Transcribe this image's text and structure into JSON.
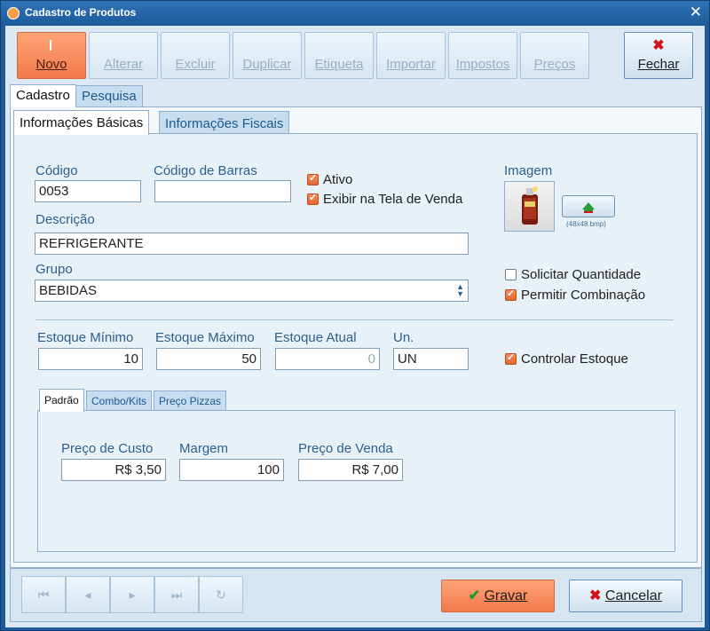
{
  "window": {
    "title": "Cadastro de Produtos"
  },
  "toolbar": {
    "buttons": [
      {
        "label": "Novo"
      },
      {
        "label": "Alterar"
      },
      {
        "label": "Excluir"
      },
      {
        "label": "Duplicar"
      },
      {
        "label": "Etiqueta"
      },
      {
        "label": "Importar"
      },
      {
        "label": "Impostos"
      },
      {
        "label": "Preços"
      }
    ],
    "close_label": "Fechar"
  },
  "main_tabs": [
    {
      "label": "Cadastro"
    },
    {
      "label": "Pesquisa"
    }
  ],
  "sub_tabs": [
    {
      "label": "Informações Básicas"
    },
    {
      "label": "Informações Fiscais"
    }
  ],
  "form": {
    "codigo": {
      "label": "Código",
      "value": "0053"
    },
    "codigo_barras": {
      "label": "Código de Barras",
      "value": ""
    },
    "ativo": {
      "label": "Ativo",
      "checked": true
    },
    "exibir_tela_venda": {
      "label": "Exibir na Tela de Venda",
      "checked": true
    },
    "imagem": {
      "label": "Imagem",
      "hint": "(48x48.bmp)"
    },
    "descricao": {
      "label": "Descrição",
      "value": "REFRIGERANTE"
    },
    "grupo": {
      "label": "Grupo",
      "value": "BEBIDAS"
    },
    "solicitar_quantidade": {
      "label": "Solicitar Quantidade",
      "checked": false
    },
    "permitir_combinacao": {
      "label": "Permitir Combinação",
      "checked": true
    },
    "estoque_minimo": {
      "label": "Estoque Mínimo",
      "value": "10"
    },
    "estoque_maximo": {
      "label": "Estoque Máximo",
      "value": "50"
    },
    "estoque_atual": {
      "label": "Estoque Atual",
      "value": "0"
    },
    "unidade": {
      "label": "Un.",
      "value": "UN"
    },
    "controlar_estoque": {
      "label": "Controlar Estoque",
      "checked": true
    }
  },
  "price_tabs": [
    {
      "label": "Padrão"
    },
    {
      "label": "Combo/Kits"
    },
    {
      "label": "Preço Pizzas"
    }
  ],
  "price": {
    "custo": {
      "label": "Preço de Custo",
      "value": "R$ 3,50"
    },
    "margem": {
      "label": "Margem",
      "value": "100"
    },
    "venda": {
      "label": "Preço de Venda",
      "value": "R$ 7,00"
    }
  },
  "actions": {
    "save": "Gravar",
    "cancel": "Cancelar"
  },
  "colors": {
    "accent": "#f2794a",
    "titlebar": "#1d5a98",
    "panel": "#e9f1f8"
  }
}
